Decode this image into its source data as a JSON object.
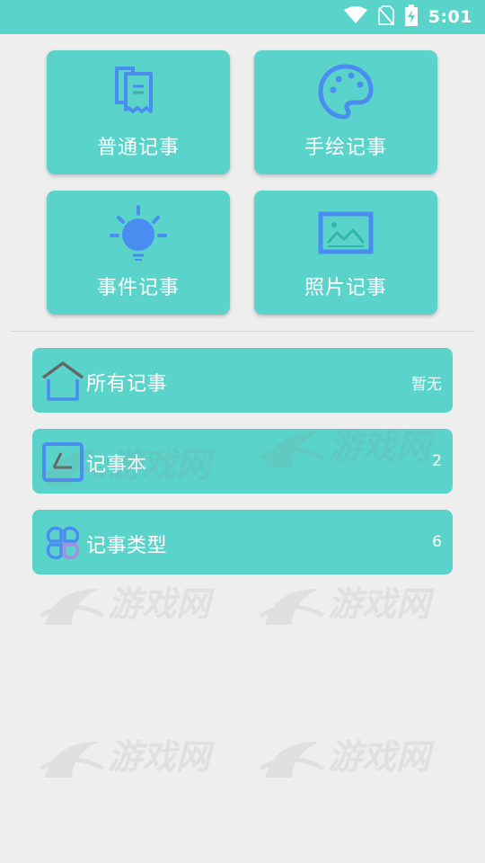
{
  "status_bar": {
    "time": "5:01",
    "icons": [
      "wifi-icon",
      "no-sim-icon",
      "battery-charging-icon"
    ]
  },
  "grid": [
    {
      "label": "普通记事",
      "icon": "note-stack-icon"
    },
    {
      "label": "手绘记事",
      "icon": "palette-icon"
    },
    {
      "label": "事件记事",
      "icon": "lightbulb-icon"
    },
    {
      "label": "照片记事",
      "icon": "picture-icon"
    }
  ],
  "list": [
    {
      "label": "所有记事",
      "count": "暂无",
      "icon": "home-icon"
    },
    {
      "label": "记事本",
      "count": "2",
      "icon": "notebook-icon"
    },
    {
      "label": "记事类型",
      "count": "6",
      "icon": "category-grid-icon"
    }
  ],
  "watermark": {
    "text": "游戏网"
  },
  "colors": {
    "accent": "#5ad3cb",
    "icon_blue": "#4a8cf0",
    "background": "#eeeeee"
  }
}
